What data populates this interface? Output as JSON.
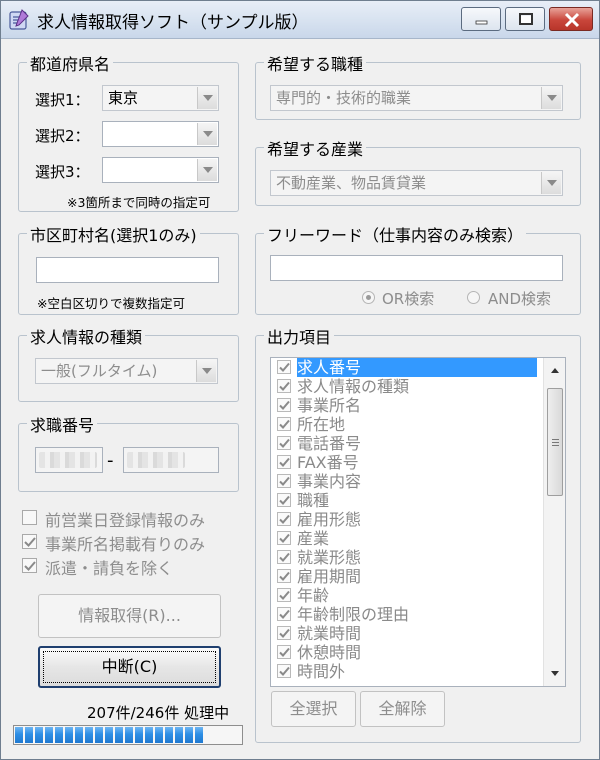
{
  "window": {
    "title": "求人情報取得ソフト（サンプル版）"
  },
  "prefecture": {
    "legend": "都道府県名",
    "select1_label": "選択1：",
    "select1_value": "東京",
    "select2_label": "選択2：",
    "select2_value": "",
    "select3_label": "選択3：",
    "select3_value": "",
    "note": "※3箇所まで同時の指定可"
  },
  "city": {
    "legend": "市区町村名(選択1のみ)",
    "value": "",
    "note": "※空白区切りで複数指定可"
  },
  "job_type": {
    "legend": "希望する職種",
    "value": "専門的・技術的職業"
  },
  "industry": {
    "legend": "希望する産業",
    "value": "不動産業、物品賃貸業"
  },
  "free_word": {
    "legend": "フリーワード（仕事内容のみ検索）",
    "value": "",
    "or_label": "OR検索",
    "and_label": "AND検索"
  },
  "info_kind": {
    "legend": "求人情報の種類",
    "value": "一般(フルタイム)"
  },
  "job_number": {
    "legend": "求職番号",
    "separator": "-"
  },
  "options": {
    "prev_day_only": "前営業日登録情報のみ",
    "with_company_name": "事業所名掲載有りのみ",
    "exclude_dispatch": "派遣・請負を除く"
  },
  "buttons": {
    "fetch": "情報取得(R)...",
    "stop": "中断(C)",
    "select_all": "全選択",
    "deselect_all": "全解除"
  },
  "output": {
    "legend": "出力項目",
    "items": [
      {
        "label": "求人番号",
        "selected": true
      },
      {
        "label": "求人情報の種類"
      },
      {
        "label": "事業所名"
      },
      {
        "label": "所在地"
      },
      {
        "label": "電話番号"
      },
      {
        "label": "FAX番号"
      },
      {
        "label": "事業内容"
      },
      {
        "label": "職種"
      },
      {
        "label": "雇用形態"
      },
      {
        "label": "産業"
      },
      {
        "label": "就業形態"
      },
      {
        "label": "雇用期間"
      },
      {
        "label": "年齢"
      },
      {
        "label": "年齢制限の理由"
      },
      {
        "label": "就業時間"
      },
      {
        "label": "休憩時間"
      },
      {
        "label": "時間外"
      }
    ]
  },
  "status": {
    "text": "207件/246件 処理中",
    "progress": 0.84
  },
  "colors": {
    "selection": "#3399ff",
    "progress": "#2d8ee5"
  }
}
